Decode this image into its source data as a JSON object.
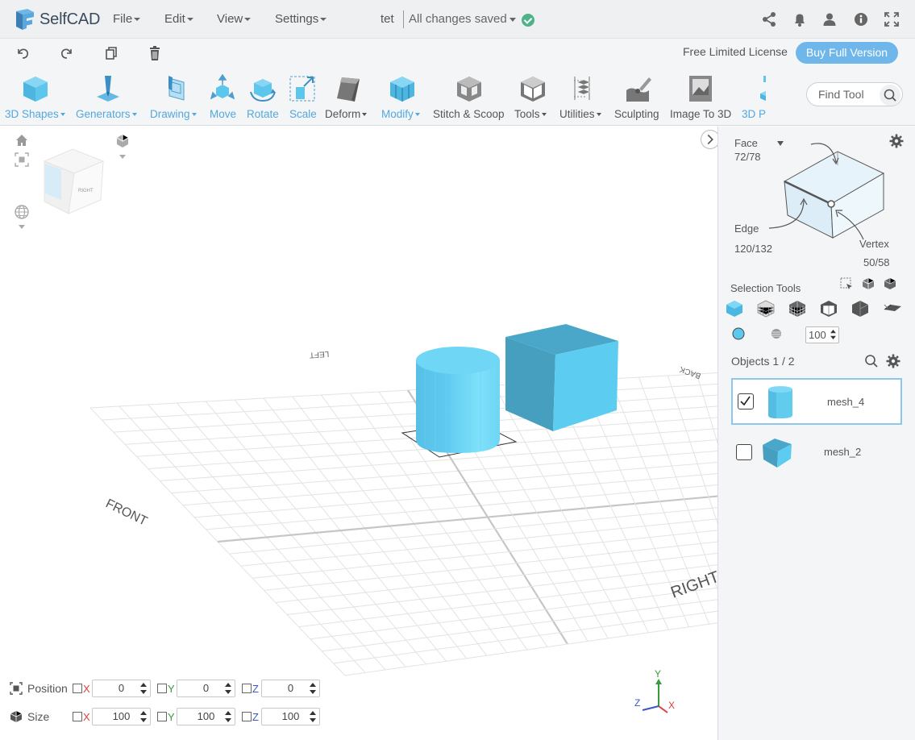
{
  "app": {
    "name": "SelfCAD"
  },
  "menus": [
    "File",
    "Edit",
    "View",
    "Settings"
  ],
  "project": {
    "name": "tet",
    "status": "All changes saved"
  },
  "license": {
    "text": "Free Limited License",
    "buy_label": "Buy Full Version"
  },
  "tools": [
    {
      "label": "3D Shapes",
      "dropdown": true,
      "style": "blue",
      "icon": "cube-icon"
    },
    {
      "label": "Generators",
      "dropdown": true,
      "style": "blue",
      "icon": "generator-icon"
    },
    {
      "label": "Drawing",
      "dropdown": true,
      "style": "blue",
      "icon": "drawing-icon"
    },
    {
      "label": "Move",
      "dropdown": false,
      "style": "blue",
      "icon": "move-icon"
    },
    {
      "label": "Rotate",
      "dropdown": false,
      "style": "blue",
      "icon": "rotate-icon"
    },
    {
      "label": "Scale",
      "dropdown": false,
      "style": "blue",
      "icon": "scale-icon"
    },
    {
      "label": "Deform",
      "dropdown": true,
      "style": "dark",
      "icon": "deform-icon"
    },
    {
      "label": "Modify",
      "dropdown": true,
      "style": "blue",
      "icon": "modify-icon"
    },
    {
      "label": "Stitch & Scoop",
      "dropdown": false,
      "style": "dark",
      "icon": "stitch-scoop-icon"
    },
    {
      "label": "Tools",
      "dropdown": true,
      "style": "dark",
      "icon": "tools-icon"
    },
    {
      "label": "Utilities",
      "dropdown": true,
      "style": "dark",
      "icon": "utilities-icon"
    },
    {
      "label": "Sculpting",
      "dropdown": false,
      "style": "dark",
      "icon": "sculpting-icon"
    },
    {
      "label": "Image To 3D",
      "dropdown": false,
      "style": "dark",
      "icon": "image-to-3d-icon"
    },
    {
      "label": "3D P",
      "dropdown": false,
      "style": "blue",
      "icon": "3d-print-icon"
    }
  ],
  "find_tool": {
    "placeholder": "Find Tool"
  },
  "viewport": {
    "labels": {
      "front": "FRONT",
      "right": "RIGHT",
      "left": "LEFT",
      "back": "BACK"
    },
    "view_cube": {
      "face_label": "RIGHT"
    },
    "axes": {
      "x": "X",
      "y": "Y",
      "z": "Z"
    }
  },
  "transform": {
    "position": {
      "label": "Position",
      "x": "0",
      "y": "0",
      "z": "0"
    },
    "size": {
      "label": "Size",
      "x": "100",
      "y": "100",
      "z": "100"
    },
    "axis_labels": {
      "x": "X",
      "y": "Y",
      "z": "Z"
    }
  },
  "selection": {
    "face": {
      "label": "Face",
      "count": "72/78"
    },
    "edge": {
      "label": "Edge",
      "count": "120/132"
    },
    "vertex": {
      "label": "Vertex",
      "count": "50/58"
    },
    "tools_title": "Selection Tools",
    "opacity": "100"
  },
  "objects": {
    "title": "Objects 1 / 2",
    "items": [
      {
        "name": "mesh_4",
        "checked": true,
        "shape": "cylinder"
      },
      {
        "name": "mesh_2",
        "checked": false,
        "shape": "cube"
      }
    ]
  },
  "colors": {
    "accent": "#53a8dd",
    "object": "#5bc8ec",
    "button": "#6fb7ea",
    "saved": "#4fb38a"
  }
}
